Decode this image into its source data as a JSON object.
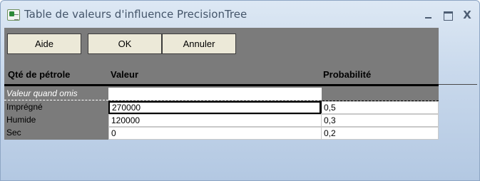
{
  "window": {
    "title": "Table de valeurs d'influence PrecisionTree",
    "icons": {
      "app": "excel-sheet-icon",
      "minimize": "minimize-icon",
      "maximize": "maximize-icon",
      "close": "close-icon"
    },
    "close_glyph": "X"
  },
  "toolbar": {
    "help_label": "Aide",
    "ok_label": "OK",
    "cancel_label": "Annuler"
  },
  "table": {
    "headers": {
      "quantity": "Qté de pétrole",
      "value": "Valeur",
      "probability": "Probabilité"
    },
    "omitted_row": {
      "label": "Valeur quand omis",
      "value": "",
      "probability": ""
    },
    "rows": [
      {
        "label": "Imprégné",
        "value": "270000",
        "probability": "0,5"
      },
      {
        "label": "Humide",
        "value": "120000",
        "probability": "0,3"
      },
      {
        "label": "Sec",
        "value": "0",
        "probability": "0,2"
      }
    ]
  },
  "colors": {
    "panel": "#7b7b7b",
    "frame": "#c9d9ec",
    "button": "#ece9d8"
  }
}
